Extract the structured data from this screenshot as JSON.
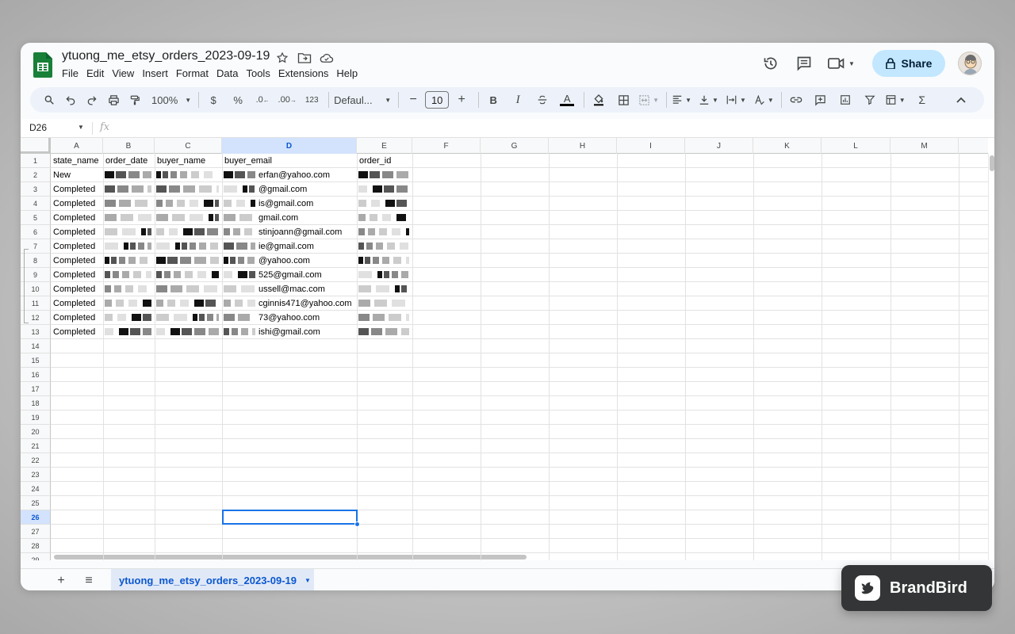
{
  "document": {
    "title": "ytuong_me_etsy_orders_2023-09-19",
    "menu": [
      "File",
      "Edit",
      "View",
      "Insert",
      "Format",
      "Data",
      "Tools",
      "Extensions",
      "Help"
    ]
  },
  "header": {
    "share_label": "Share",
    "icons": [
      "history-icon",
      "comment-icon",
      "video-call-icon",
      "lock-icon",
      "avatar"
    ]
  },
  "toolbar": {
    "zoom": "100%",
    "currency": "$",
    "percent": "%",
    "decrease_decimal": ".0",
    "increase_decimal": ".00",
    "number_format": "123",
    "font": "Defaul...",
    "font_size": "10",
    "bold": "B",
    "italic": "I",
    "underline_color": "A",
    "text_color": "A",
    "sum": "Σ"
  },
  "formula_bar": {
    "name_box": "D26",
    "fx": "fx"
  },
  "grid": {
    "columns": [
      "A",
      "B",
      "C",
      "D",
      "E",
      "F",
      "G",
      "H",
      "I",
      "J",
      "K",
      "L",
      "M"
    ],
    "selected_column": "D",
    "selected_row": "26",
    "rows": [
      "1",
      "2",
      "3",
      "4",
      "5",
      "6",
      "7",
      "8",
      "9",
      "10",
      "11",
      "12",
      "13",
      "14",
      "15",
      "16",
      "17",
      "18",
      "19",
      "20",
      "21",
      "22",
      "23",
      "24",
      "25",
      "26",
      "27",
      "28",
      "29"
    ],
    "headers": [
      "state_name",
      "order_date",
      "buyer_name",
      "buyer_email",
      "order_id"
    ],
    "state_names": [
      "New",
      "Completed",
      "Completed",
      "Completed",
      "Completed",
      "Completed",
      "Completed",
      "Completed",
      "Completed",
      "Completed",
      "Completed",
      "Completed"
    ],
    "emails_visible": [
      "erfan@yahoo.com",
      "@gmail.com",
      "is@gmail.com",
      "gmail.com",
      "stinjoann@gmail.com",
      "ie@gmail.com",
      "@yahoo.com",
      "525@gmail.com",
      "ussell@mac.com",
      "cginnis471@yahoo.com",
      "73@yahoo.com",
      "ishi@gmail.com"
    ]
  },
  "sheet_tabs": {
    "add": "+",
    "all_sheets": "≡",
    "active": "ytuong_me_etsy_orders_2023-09-19"
  },
  "watermark": {
    "text": "BrandBird"
  },
  "colors": {
    "accent": "#0b57d0",
    "share_bg": "#c2e7ff",
    "selection": "#1a73e8",
    "sheets_green": "#188038"
  }
}
